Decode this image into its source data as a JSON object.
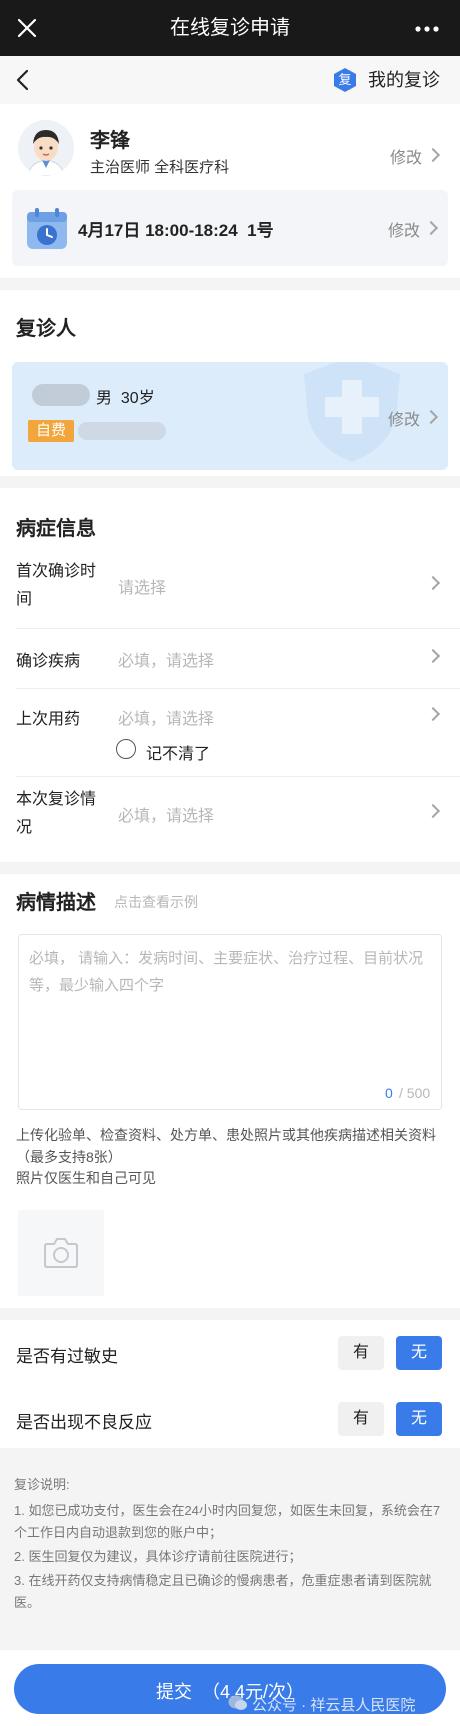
{
  "window": {
    "title": "在线复诊申请"
  },
  "nav": {
    "my_label": "我的复诊",
    "my_badge": "复"
  },
  "doctor": {
    "name": "李锋",
    "title": "主治医师 全科医疗科",
    "edit_label": "修改",
    "schedule": "4月17日 18:00-18:24  1号",
    "schedule_edit_label": "修改"
  },
  "patient": {
    "section_title": "复诊人",
    "gender_age": "男  30岁",
    "payment_tag": "自费",
    "edit_label": "修改"
  },
  "symptoms": {
    "section_title": "病症信息",
    "rows": [
      {
        "label": "首次确诊时间",
        "placeholder": "请选择"
      },
      {
        "label": "确诊疾病",
        "placeholder": "必填，请选择"
      },
      {
        "label": "上次用药",
        "placeholder": "必填，请选择"
      },
      {
        "label": "本次复诊情况",
        "placeholder": "必填，请选择"
      }
    ],
    "forgot_label": "记不清了"
  },
  "description": {
    "section_title": "病情描述",
    "example_link": "点击查看示例",
    "placeholder": "必填， 请输入：发病时间、主要症状、治疗过程、目前状况等，最少输入四个字",
    "count": "0",
    "max": "/ 500",
    "upload_hint": "上传化验单、检查资料、处方单、患处照片或其他疾病描述相关资料（最多支持8张）",
    "visibility_hint": "照片仅医生和自己可见"
  },
  "allergy": {
    "label": "是否有过敏史",
    "yes": "有",
    "no": "无",
    "selected": "无"
  },
  "adverse": {
    "label": "是否出现不良反应",
    "yes": "有",
    "no": "无",
    "selected": "无"
  },
  "notes": {
    "title": "复诊说明:",
    "items": [
      "1. 如您已成功支付，医生会在24小时内回复您，如医生未回复，系统会在7个工作日内自动退款到您的账户中；",
      "2. 医生回复仅为建议，具体诊疗请前往医院进行；",
      "3. 在线开药仅支持病情稳定且已确诊的慢病患者，危重症患者请到医院就医。"
    ]
  },
  "submit": {
    "label": "提交",
    "price": "（4.4元/次）"
  },
  "watermark": "公众号 · 祥云县人民医院",
  "colors": {
    "accent": "#3a7bea",
    "card_blue": "#dcecfb",
    "tag_orange": "#f2a53a"
  }
}
